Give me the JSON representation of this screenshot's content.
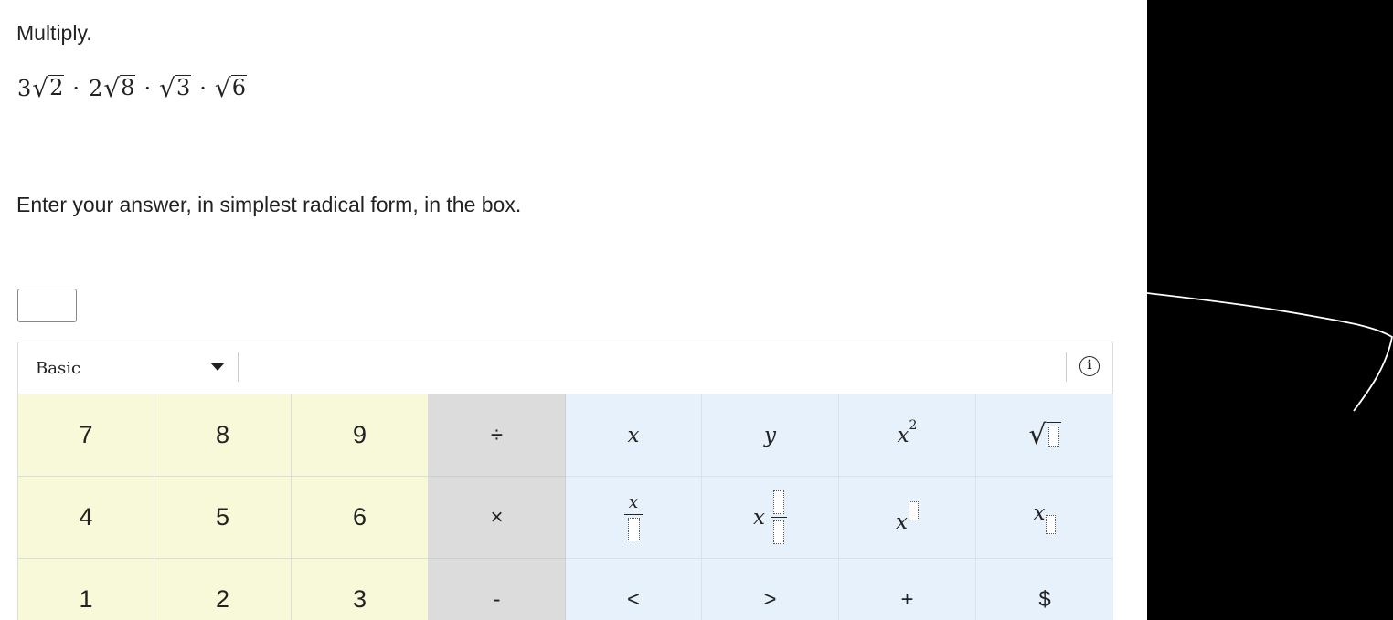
{
  "question": {
    "instruction": "Multiply.",
    "expression": [
      {
        "coef": "3",
        "radicand": "2"
      },
      {
        "coef": "2",
        "radicand": "8"
      },
      {
        "coef": "",
        "radicand": "3"
      },
      {
        "coef": "",
        "radicand": "6"
      }
    ],
    "operator": "·",
    "prompt": "Enter your answer, in simplest radical form, in the box.",
    "answer_value": ""
  },
  "keypad": {
    "mode": "Basic",
    "info_icon": "info-icon",
    "rows": [
      [
        "7",
        "8",
        "9",
        "÷",
        "x",
        "y",
        "x",
        "√"
      ],
      [
        "4",
        "5",
        "6",
        "×",
        "x",
        "x",
        "x",
        "x"
      ],
      [
        "1",
        "2",
        "3",
        "-",
        "<",
        ">",
        "+",
        "$"
      ]
    ],
    "square_exponent": "2",
    "colors": {
      "number_keys": "#f8f9d9",
      "operator_keys": "#dcdcdc",
      "symbol_keys": "#e6f1fb"
    }
  }
}
